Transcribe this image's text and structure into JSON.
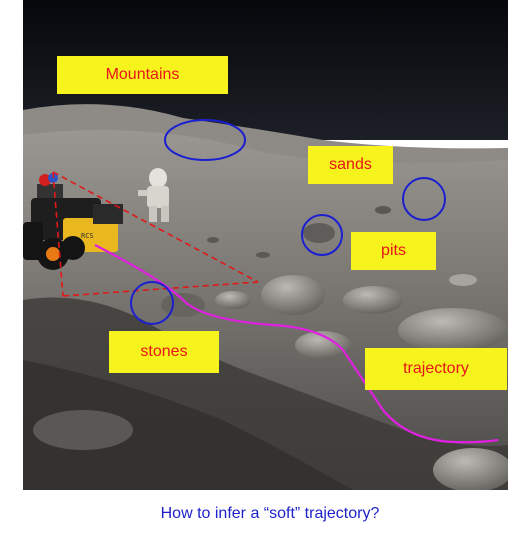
{
  "labels": {
    "mountains": "Mountains",
    "sands": "sands",
    "pits": "pits",
    "stones": "stones",
    "trajectory": "trajectory"
  },
  "robot_label": "RCS",
  "caption": "How to infer a “soft” trajectory?",
  "colors": {
    "label_bg": "#f7f31c",
    "label_text": "#e8141b",
    "circle": "#1b1fd0",
    "trajectory": "#e020e0",
    "fov_dash": "#e01818",
    "caption": "#1f22c8"
  }
}
